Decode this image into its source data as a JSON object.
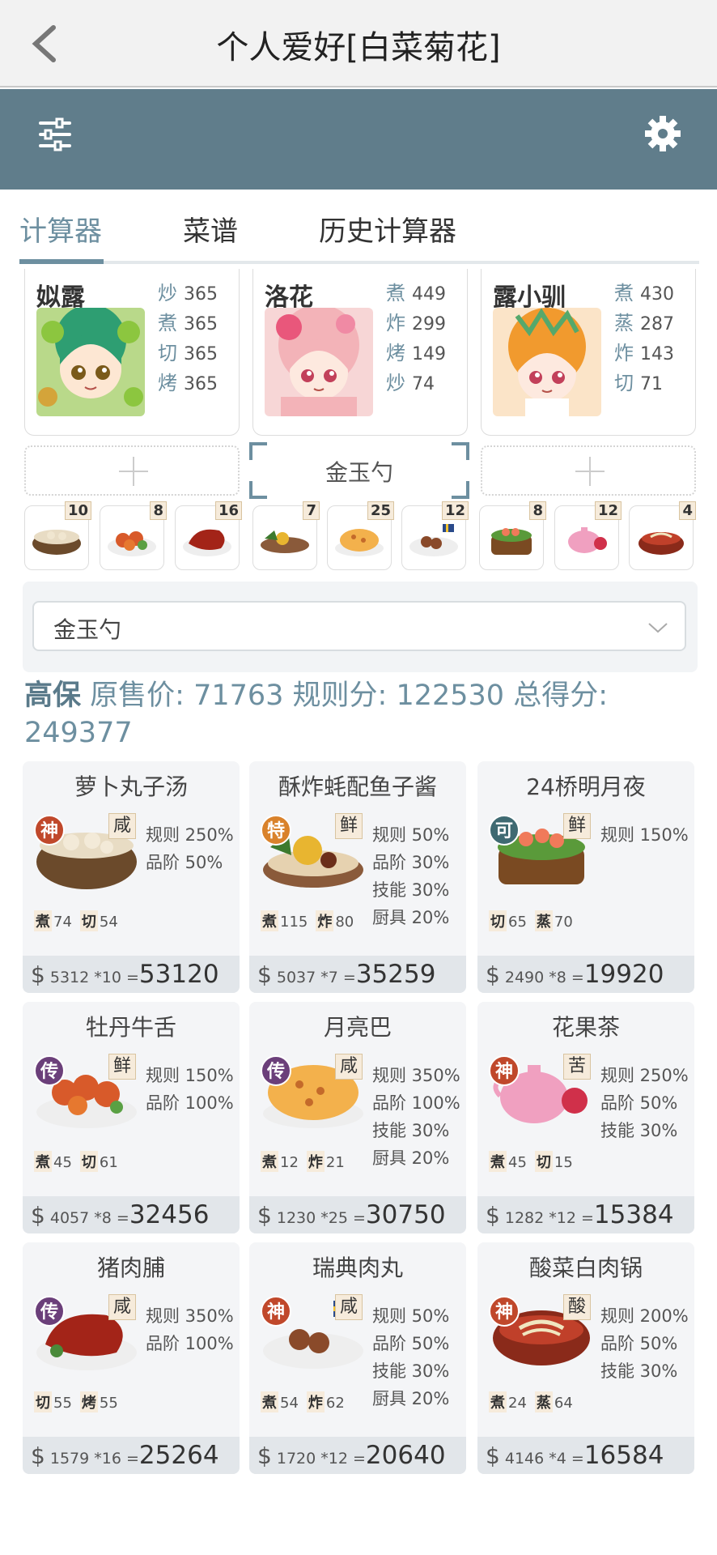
{
  "header": {
    "title": "个人爱好[白菜菊花]"
  },
  "tabs": [
    {
      "label": "计算器"
    },
    {
      "label": "菜谱"
    },
    {
      "label": "历史计算器"
    }
  ],
  "chefs": [
    {
      "name": "姒露",
      "stats": [
        {
          "k": "炒",
          "v": "365"
        },
        {
          "k": "煮",
          "v": "365"
        },
        {
          "k": "切",
          "v": "365"
        },
        {
          "k": "烤",
          "v": "365"
        }
      ]
    },
    {
      "name": "洛花",
      "stats": [
        {
          "k": "煮",
          "v": "449"
        },
        {
          "k": "炸",
          "v": "299"
        },
        {
          "k": "烤",
          "v": "149"
        },
        {
          "k": "炒",
          "v": "74"
        }
      ]
    },
    {
      "name": "露小驯",
      "stats": [
        {
          "k": "煮",
          "v": "430"
        },
        {
          "k": "蒸",
          "v": "287"
        },
        {
          "k": "炸",
          "v": "143"
        },
        {
          "k": "切",
          "v": "71"
        }
      ]
    }
  ],
  "equipment": {
    "selected": "金玉勺"
  },
  "dish_counts": [
    "10",
    "8",
    "16",
    "7",
    "25",
    "12",
    "8",
    "12",
    "4"
  ],
  "select": {
    "value": "金玉勺"
  },
  "score": {
    "line1": "原售价: 71763 规则分: 122530 总得分:",
    "tag": "高保",
    "line2": "249377"
  },
  "recipes": [
    {
      "name": "萝卜丸子汤",
      "grade": "神",
      "flavor": "咸",
      "rules": [
        "规则 250%",
        "品阶 50%"
      ],
      "req": [
        {
          "k": "煮",
          "v": "74"
        },
        {
          "k": "切",
          "v": "54"
        }
      ],
      "price": "5312 *10",
      "eq": "=",
      "total": "53120"
    },
    {
      "name": "酥炸蚝配鱼子酱",
      "grade": "特",
      "flavor": "鲜",
      "rules": [
        "规则 50%",
        "品阶 30%",
        "技能 30%",
        "厨具 20%"
      ],
      "req": [
        {
          "k": "煮",
          "v": "115"
        },
        {
          "k": "炸",
          "v": "80"
        }
      ],
      "price": "5037 *7",
      "eq": "=",
      "total": "35259"
    },
    {
      "name": "24桥明月夜",
      "grade": "可",
      "flavor": "鲜",
      "rules": [
        "规则 150%"
      ],
      "req": [
        {
          "k": "切",
          "v": "65"
        },
        {
          "k": "蒸",
          "v": "70"
        }
      ],
      "price": "2490 *8",
      "eq": "=",
      "total": "19920"
    },
    {
      "name": "牡丹牛舌",
      "grade": "传",
      "flavor": "鲜",
      "rules": [
        "规则 150%",
        "品阶 100%"
      ],
      "req": [
        {
          "k": "煮",
          "v": "45"
        },
        {
          "k": "切",
          "v": "61"
        }
      ],
      "price": "4057 *8",
      "eq": "=",
      "total": "32456"
    },
    {
      "name": "月亮巴",
      "grade": "传",
      "flavor": "咸",
      "rules": [
        "规则 350%",
        "品阶 100%",
        "技能 30%",
        "厨具 20%"
      ],
      "req": [
        {
          "k": "煮",
          "v": "12"
        },
        {
          "k": "炸",
          "v": "21"
        }
      ],
      "price": "1230 *25",
      "eq": "=",
      "total": "30750"
    },
    {
      "name": "花果茶",
      "grade": "神",
      "flavor": "苦",
      "rules": [
        "规则 250%",
        "品阶 50%",
        "技能 30%"
      ],
      "req": [
        {
          "k": "煮",
          "v": "45"
        },
        {
          "k": "切",
          "v": "15"
        }
      ],
      "price": "1282 *12",
      "eq": "=",
      "total": "15384"
    },
    {
      "name": "猪肉脯",
      "grade": "传",
      "flavor": "咸",
      "rules": [
        "规则 350%",
        "品阶 100%"
      ],
      "req": [
        {
          "k": "切",
          "v": "55"
        },
        {
          "k": "烤",
          "v": "55"
        }
      ],
      "price": "1579 *16",
      "eq": "=",
      "total": "25264"
    },
    {
      "name": "瑞典肉丸",
      "grade": "神",
      "flavor": "咸",
      "rules": [
        "规则 50%",
        "品阶 50%",
        "技能 30%",
        "厨具 20%"
      ],
      "req": [
        {
          "k": "煮",
          "v": "54"
        },
        {
          "k": "炸",
          "v": "62"
        }
      ],
      "price": "1720 *12",
      "eq": "=",
      "total": "20640"
    },
    {
      "name": "酸菜白肉锅",
      "grade": "神",
      "flavor": "酸",
      "rules": [
        "规则 200%",
        "品阶 50%",
        "技能 30%"
      ],
      "req": [
        {
          "k": "煮",
          "v": "24"
        },
        {
          "k": "蒸",
          "v": "64"
        }
      ],
      "price": "4146 *4",
      "eq": "=",
      "total": "16584"
    }
  ],
  "grade_colors": {
    "神": "#c0482b",
    "特": "#d9822b",
    "可": "#3f6a72",
    "传": "#6b3f7a"
  }
}
